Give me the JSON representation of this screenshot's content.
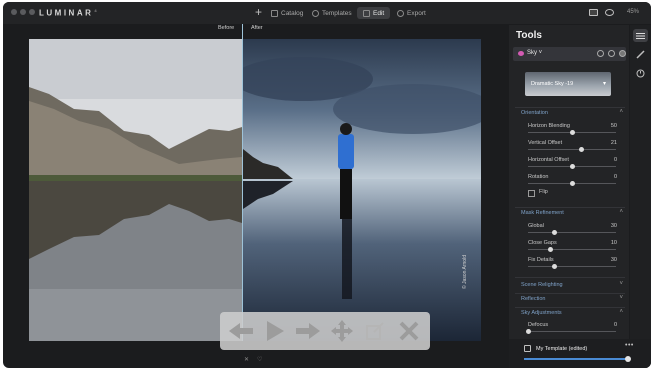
{
  "app": {
    "logo": "LUMINAR",
    "version": "4"
  },
  "tabs": [
    {
      "label": "Catalog"
    },
    {
      "label": "Templates"
    },
    {
      "label": "Edit"
    },
    {
      "label": "Export"
    }
  ],
  "zoom": "45%",
  "canvas": {
    "before_label": "Before",
    "after_label": "After",
    "watermark": "© Jason Arnold"
  },
  "panel": {
    "title": "Tools",
    "active_tool": "Sky",
    "sky_preset": "Dramatic Sky -19",
    "sections": {
      "orientation": "Orientation",
      "mask_refinement": "Mask Refinement",
      "scene_relighting": "Scene Relighting",
      "reflection": "Reflection",
      "sky_adjustments": "Sky Adjustments"
    },
    "orientation_sliders": [
      {
        "label": "Horizon Blending",
        "value": "50",
        "level": 0.5
      },
      {
        "label": "Vertical Offset",
        "value": "21",
        "level": 0.6
      },
      {
        "label": "Horizontal Offset",
        "value": "0",
        "level": 0.5
      },
      {
        "label": "Rotation",
        "value": "0",
        "level": 0.5
      }
    ],
    "flip_label": "Flip",
    "mask_sliders": [
      {
        "label": "Global",
        "value": "30",
        "level": 0.3
      },
      {
        "label": "Close Gaps",
        "value": "10",
        "level": 0.25
      },
      {
        "label": "Fix Details",
        "value": "30",
        "level": 0.3
      }
    ],
    "defocus": {
      "label": "Defocus",
      "value": "0",
      "level": 0.0
    }
  },
  "template": {
    "label": "My Template (edited)",
    "more": "•••"
  },
  "colors": {
    "accent": "#4a8bd4",
    "panel_bg": "#232426",
    "sky_dot": "#d35bb3"
  }
}
